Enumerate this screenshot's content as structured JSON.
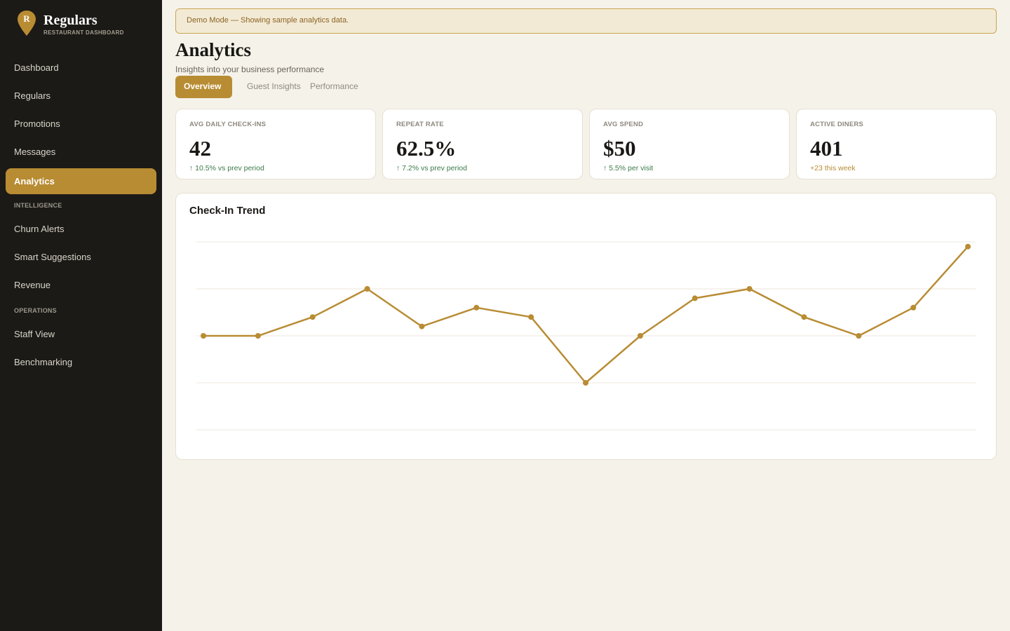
{
  "brand": {
    "logo_letter": "R",
    "name": "Regulars",
    "subtitle": "RESTAURANT DASHBOARD"
  },
  "sidebar": {
    "items": [
      {
        "label": "Dashboard"
      },
      {
        "label": "Regulars"
      },
      {
        "label": "Promotions"
      },
      {
        "label": "Messages"
      },
      {
        "label": "Analytics",
        "active": true
      }
    ],
    "section_intelligence": "INTELLIGENCE",
    "intelligence_items": [
      {
        "label": "Churn Alerts"
      },
      {
        "label": "Smart Suggestions"
      },
      {
        "label": "Revenue"
      }
    ],
    "section_operations": "OPERATIONS",
    "operations_items": [
      {
        "label": "Staff View"
      },
      {
        "label": "Benchmarking"
      }
    ]
  },
  "banner": {
    "text": "Demo Mode — Showing sample analytics data."
  },
  "header": {
    "title": "Analytics",
    "subtitle": "Insights into your business performance"
  },
  "tabs": [
    {
      "label": "Overview",
      "active": true
    },
    {
      "label": "Guest Insights"
    },
    {
      "label": "Performance"
    }
  ],
  "stats": [
    {
      "label": "AVG DAILY CHECK-INS",
      "value": "42",
      "delta": "↑ 10.5% vs prev period",
      "tone": "up"
    },
    {
      "label": "REPEAT RATE",
      "value": "62.5%",
      "delta": "↑ 7.2% vs prev period",
      "tone": "up"
    },
    {
      "label": "AVG SPEND",
      "value": "$50",
      "delta": "↑ 5.5% per visit",
      "tone": "up"
    },
    {
      "label": "ACTIVE DINERS",
      "value": "401",
      "delta": "+23 this week",
      "tone": "gold"
    }
  ],
  "colors": {
    "accent": "#b88c33",
    "sidebar_bg": "#1c1a16",
    "page_bg": "#f5f2ea",
    "positive": "#3c7a48"
  },
  "chart_data": {
    "type": "line",
    "title": "Check-In Trend",
    "x": [
      1,
      2,
      3,
      4,
      5,
      6,
      7,
      8,
      9,
      10,
      11,
      12,
      13,
      14,
      15
    ],
    "series": [
      {
        "values": [
          38,
          38,
          42,
          48,
          40,
          44,
          42,
          28,
          38,
          46,
          48,
          42,
          38,
          44,
          57
        ]
      }
    ],
    "ylim": [
      18,
      58
    ],
    "grid": true,
    "legend": "none"
  }
}
